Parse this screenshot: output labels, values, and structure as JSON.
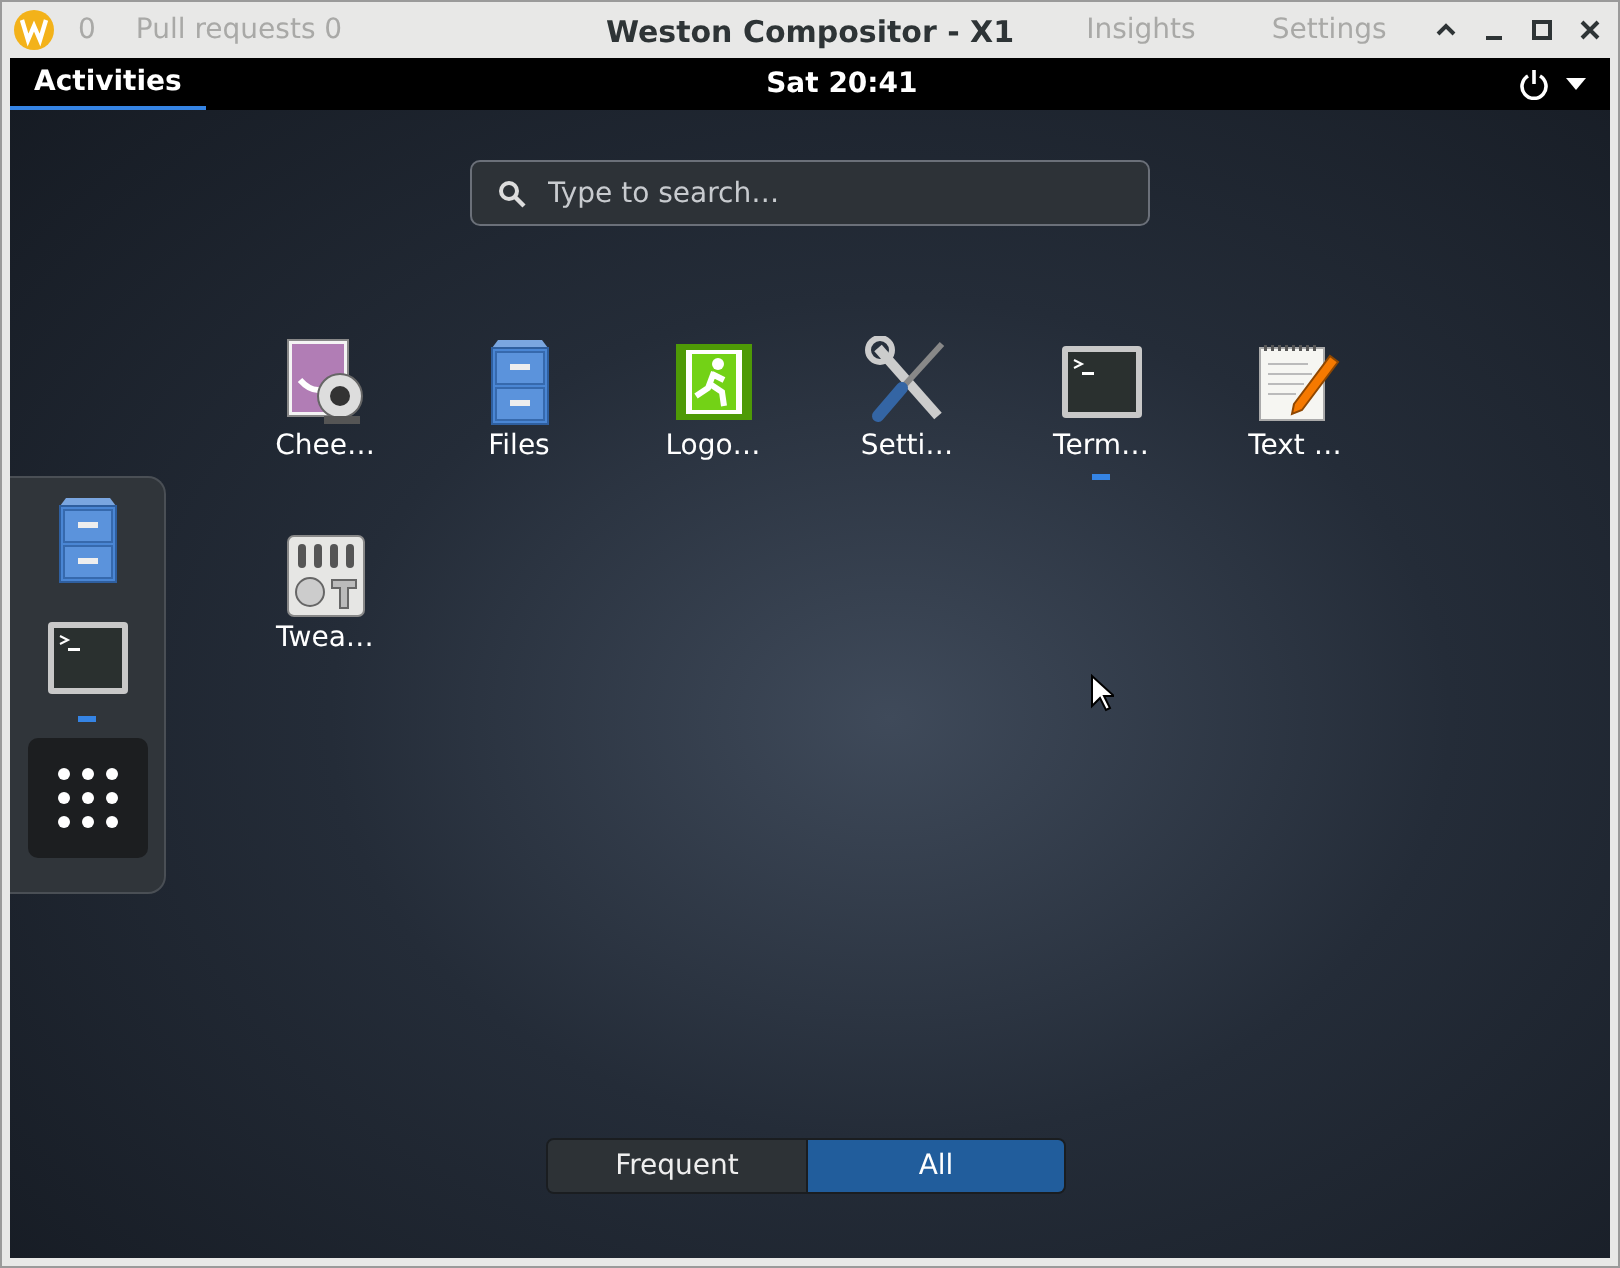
{
  "window": {
    "title": "Weston Compositor - X1",
    "ghost_texts": [
      "0",
      "Pull requests 0",
      "Insights",
      "Settings"
    ]
  },
  "top_bar": {
    "activities": {
      "label": "Activities",
      "selected": true
    },
    "clock": "Sat 20:41"
  },
  "search": {
    "placeholder": "Type to search…"
  },
  "apps": [
    {
      "kind": "camera",
      "label": "Chee…",
      "running": false
    },
    {
      "kind": "cabinet",
      "label": "Files",
      "running": false
    },
    {
      "kind": "exit",
      "label": "Logo…",
      "running": false
    },
    {
      "kind": "tools",
      "label": "Setti…",
      "running": false
    },
    {
      "kind": "terminal",
      "label": "Term…",
      "running": true
    },
    {
      "kind": "notepad",
      "label": "Text …",
      "running": false
    },
    {
      "kind": "tweaks",
      "label": "Twea…",
      "running": false
    }
  ],
  "dash": [
    {
      "kind": "cabinet",
      "running": false
    },
    {
      "kind": "terminal",
      "running": true
    },
    {
      "kind": "grid",
      "running": false
    }
  ],
  "view_toggle": [
    {
      "label": "Frequent",
      "selected": false
    },
    {
      "label": "All",
      "selected": true
    }
  ]
}
